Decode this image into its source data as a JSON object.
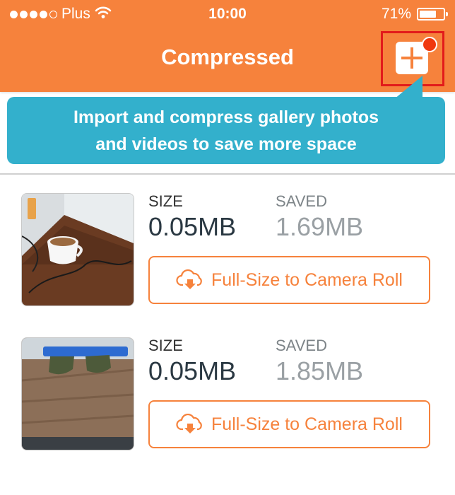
{
  "status_bar": {
    "carrier": "Plus",
    "time": "10:00",
    "battery_percent": "71%",
    "battery_level": 0.71,
    "signal_bars_filled": 4,
    "signal_bars_total": 5
  },
  "header": {
    "title": "Compressed",
    "background_color": "#F6823C",
    "add_button_icon": "plus-icon",
    "notification_badge_color": "#F0380E"
  },
  "tooltip": {
    "line1": "Import and compress gallery photos",
    "line2": "and videos to save more space",
    "background_color": "#33B0CC"
  },
  "items": [
    {
      "thumbnail": "photo-coffee-cup",
      "size_label": "SIZE",
      "size_value": "0.05MB",
      "saved_label": "SAVED",
      "saved_value": "1.69MB",
      "action_label": "Full-Size to Camera Roll",
      "action_icon": "cloud-download-icon"
    },
    {
      "thumbnail": "photo-sunglasses",
      "size_label": "SIZE",
      "size_value": "0.05MB",
      "saved_label": "SAVED",
      "saved_value": "1.85MB",
      "action_label": "Full-Size to Camera Roll",
      "action_icon": "cloud-download-icon"
    }
  ]
}
